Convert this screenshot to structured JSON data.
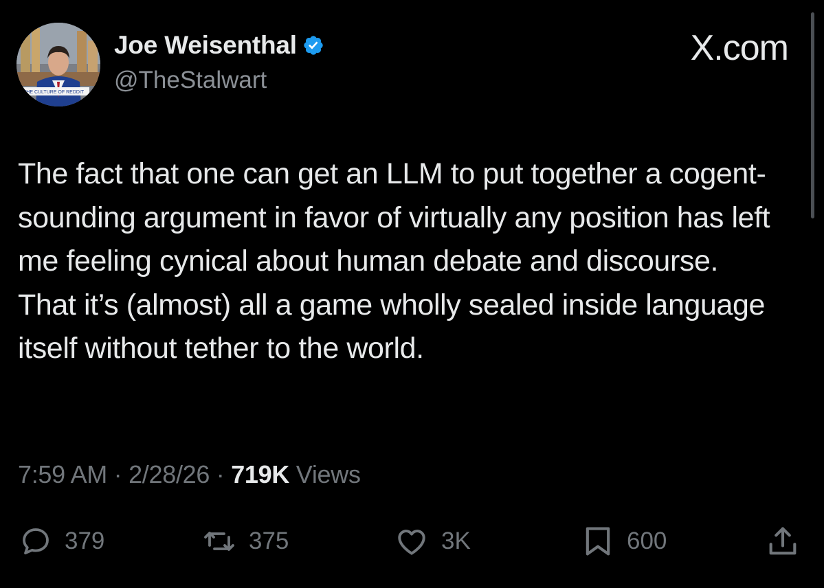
{
  "header": {
    "display_name": "Joe Weisenthal",
    "handle": "@TheStalwart",
    "verified_icon": "verified-badge-icon",
    "brand": "X.com",
    "avatar_caption": "THE CULTURE OF REDDIT"
  },
  "tweet": {
    "text": "The fact that one can get an LLM to put together a cogent-sounding argument in favor of virtually any position has left me feeling cynical about human debate and discourse. That it’s (almost) all a game wholly sealed inside language itself without tether to the world."
  },
  "meta": {
    "time": "7:59 AM",
    "sep1": " · ",
    "date": "2/28/26",
    "sep2": " · ",
    "views_count": "719K",
    "views_label": " Views"
  },
  "actions": {
    "replies": "379",
    "reposts": "375",
    "likes": "3K",
    "bookmarks": "600"
  },
  "colors": {
    "background": "#000000",
    "text": "#e7e9ea",
    "secondary": "#71767b",
    "verified": "#1d9bf0"
  }
}
